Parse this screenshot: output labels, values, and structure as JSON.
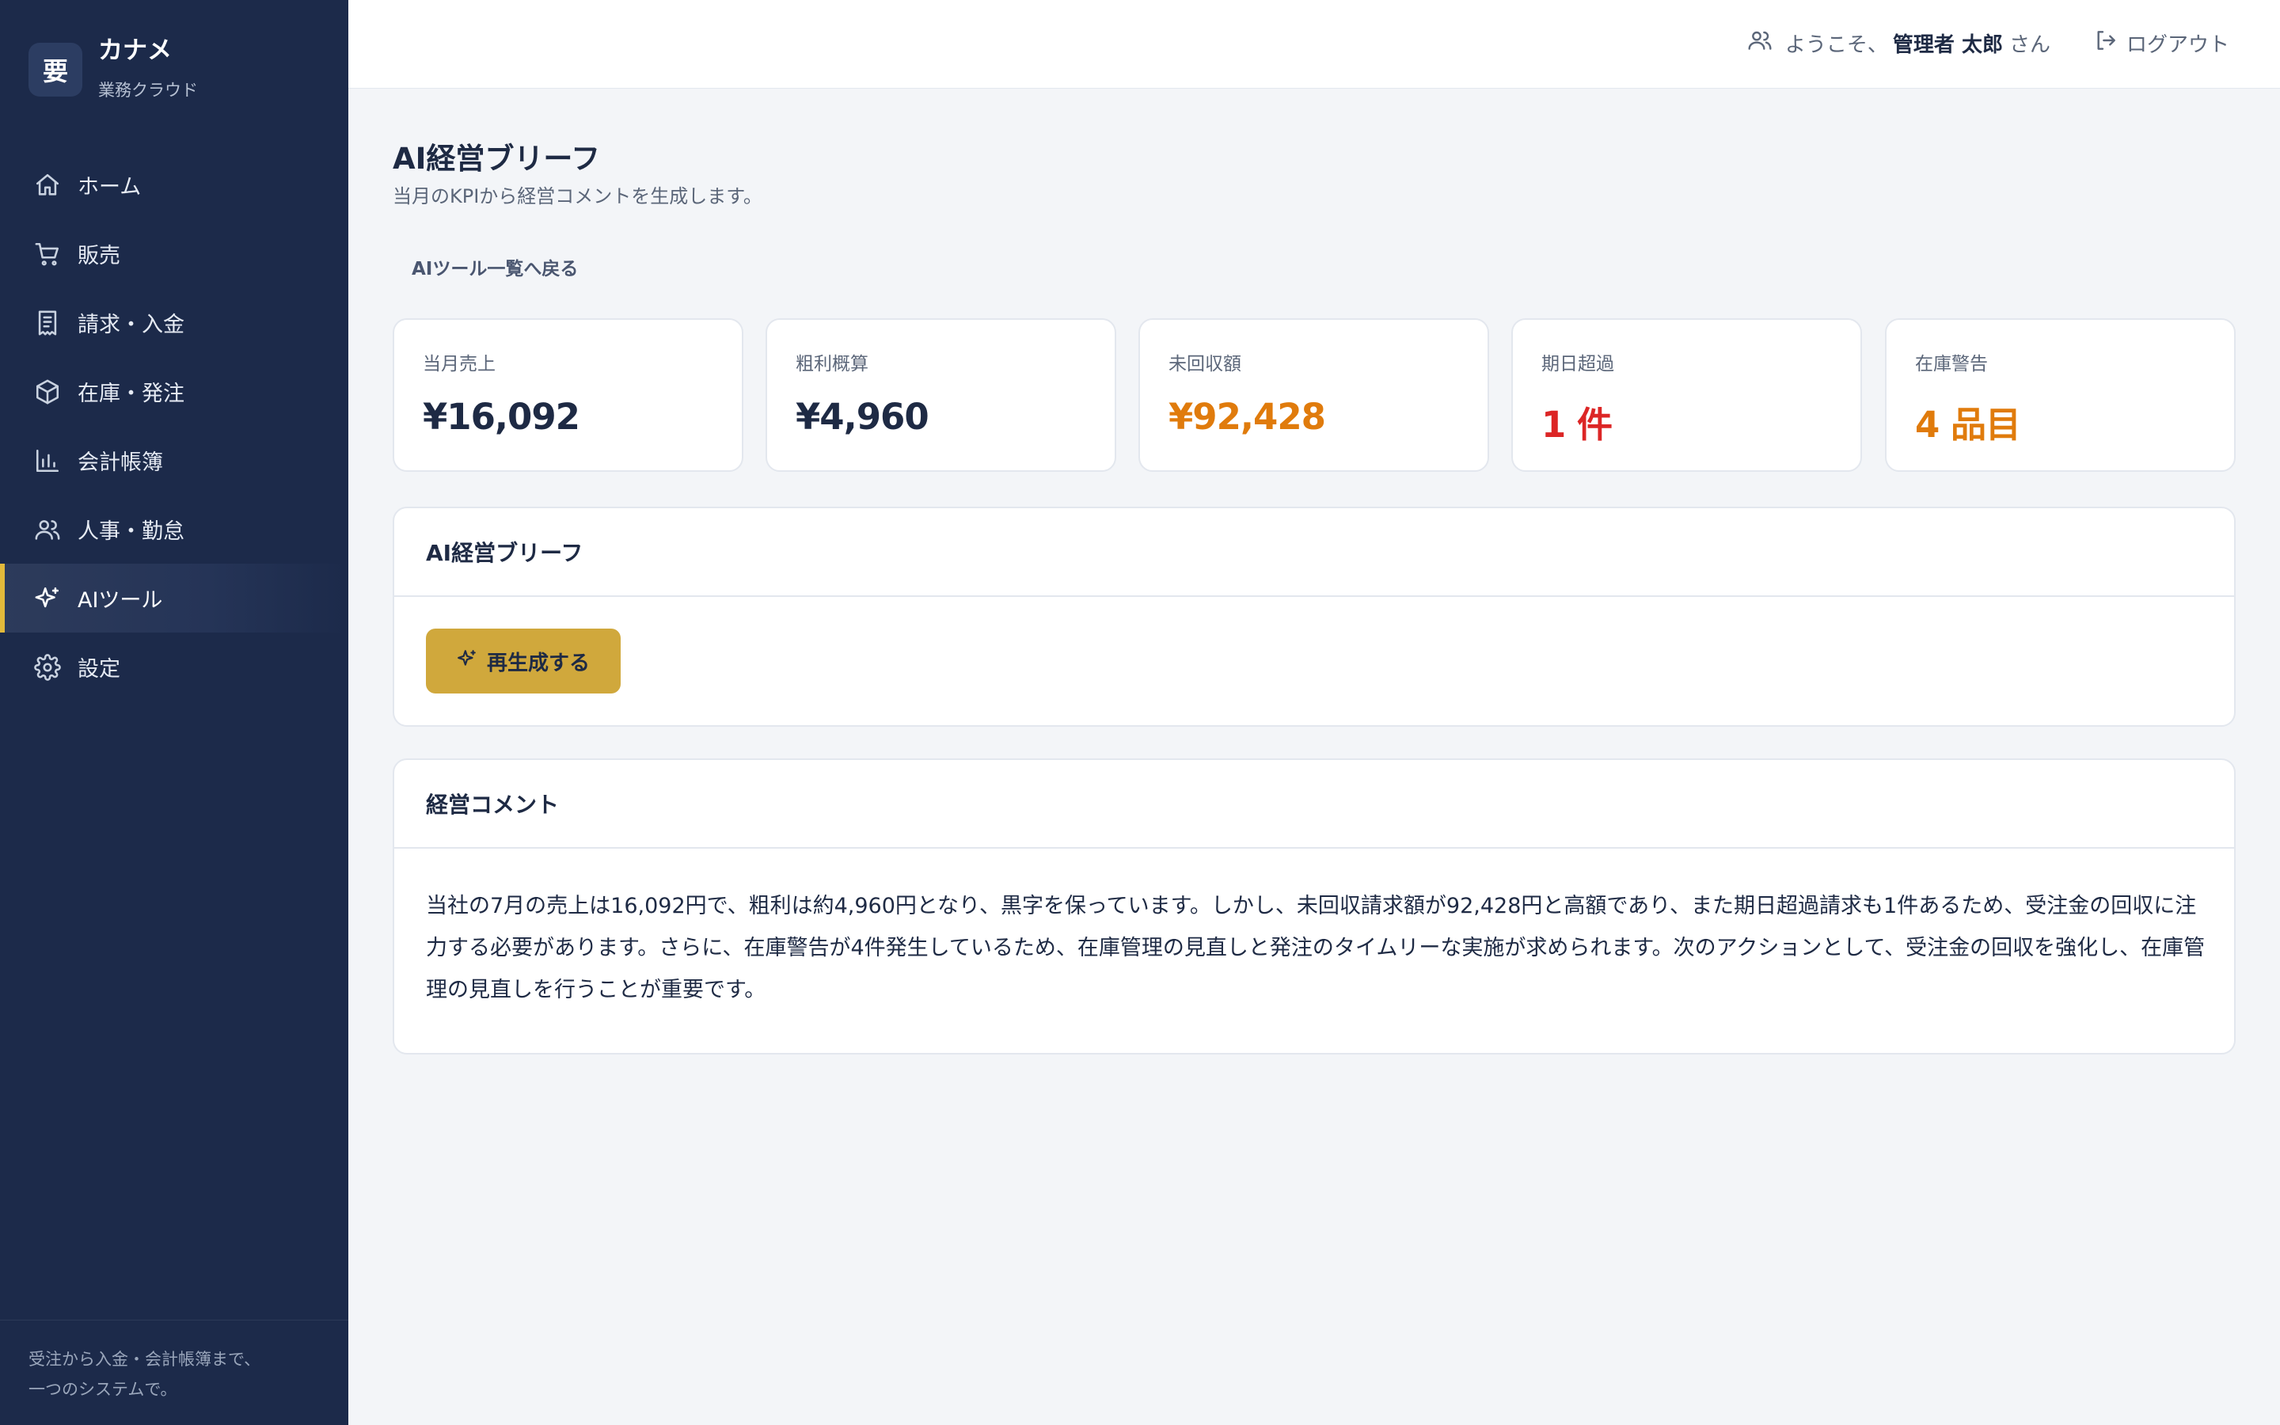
{
  "brand": {
    "logo_char": "要",
    "name": "カナメ",
    "subtitle": "業務クラウド"
  },
  "sidebar": {
    "items": [
      {
        "label": "ホーム",
        "icon": "home-icon"
      },
      {
        "label": "販売",
        "icon": "cart-icon"
      },
      {
        "label": "請求・入金",
        "icon": "receipt-icon"
      },
      {
        "label": "在庫・発注",
        "icon": "box-icon"
      },
      {
        "label": "会計帳簿",
        "icon": "bar-chart-icon"
      },
      {
        "label": "人事・勤怠",
        "icon": "users-icon"
      },
      {
        "label": "AIツール",
        "icon": "sparkle-icon",
        "active": true
      },
      {
        "label": "設定",
        "icon": "gear-icon"
      }
    ],
    "footer_line1": "受注から入金・会計帳簿まで、",
    "footer_line2": "一つのシステムで。"
  },
  "header": {
    "welcome_prefix": "ようこそ、",
    "user_name": "管理者 太郎",
    "welcome_suffix": "さん",
    "logout_label": "ログアウト"
  },
  "page": {
    "title": "AI経営ブリーフ",
    "subtitle": "当月のKPIから経営コメントを生成します。",
    "back_link": "AIツール一覧へ戻る"
  },
  "kpis": [
    {
      "label": "当月売上",
      "value": "¥16,092",
      "color": "#1e2a44"
    },
    {
      "label": "粗利概算",
      "value": "¥4,960",
      "color": "#1e2a44"
    },
    {
      "label": "未回収額",
      "value": "¥92,428",
      "color": "#e07b0c"
    },
    {
      "label": "期日超過",
      "value": "1 件",
      "color": "#dc2626"
    },
    {
      "label": "在庫警告",
      "value": "4 品目",
      "color": "#e07b0c"
    }
  ],
  "brief_card": {
    "title": "AI経営ブリーフ",
    "regen_label": "再生成する"
  },
  "comment_card": {
    "title": "経営コメント",
    "body": "当社の7月の売上は16,092円で、粗利は約4,960円となり、黒字を保っています。しかし、未回収請求額が92,428円と高額であり、また期日超過請求も1件あるため、受注金の回収に注力する必要があります。さらに、在庫警告が4件発生しているため、在庫管理の見直しと発注のタイムリーな実施が求められます。次のアクションとして、受注金の回収を強化し、在庫管理の見直しを行うことが重要です。"
  },
  "colors": {
    "sidebar_bg": "#1c2a4a",
    "accent": "#e2b93b",
    "button": "#d0a83c",
    "warning": "#e07b0c",
    "danger": "#dc2626"
  }
}
